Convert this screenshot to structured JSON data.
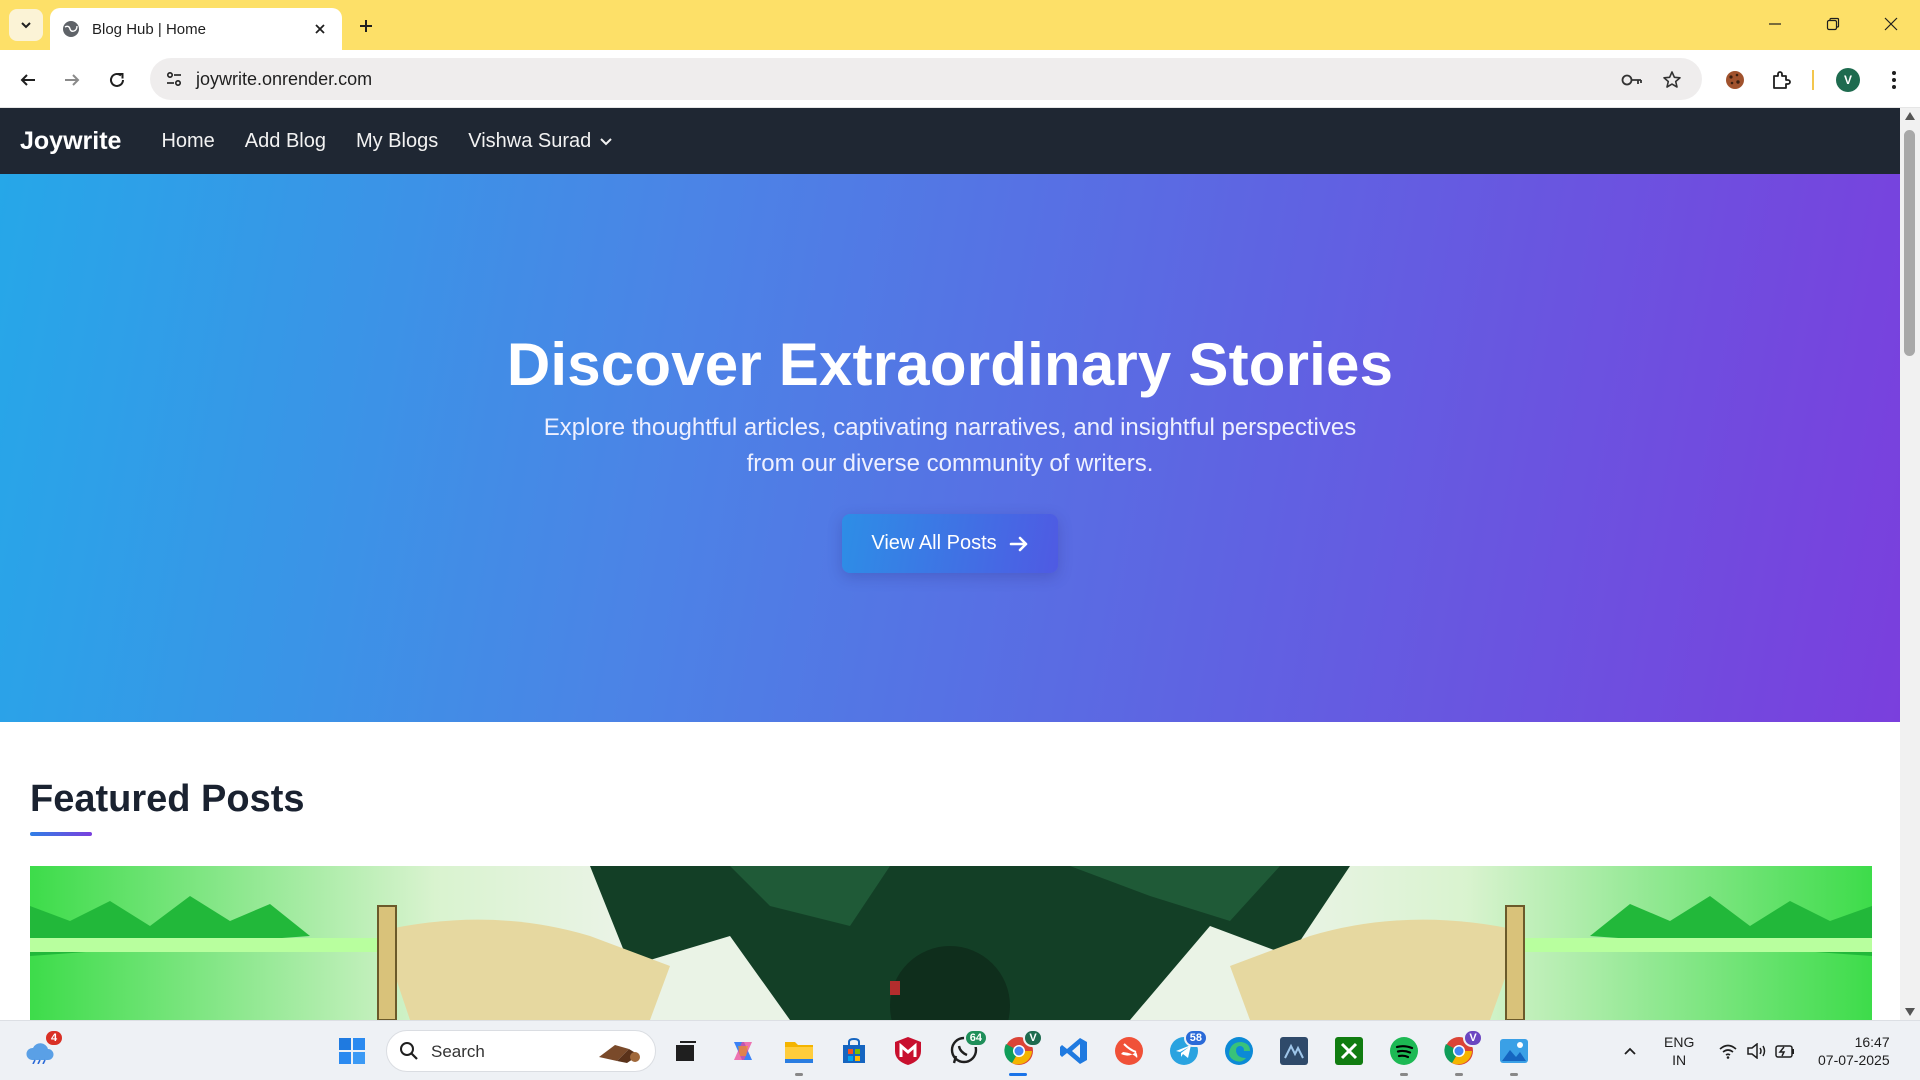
{
  "browser": {
    "tab_title": "Blog Hub | Home",
    "url": "joywrite.onrender.com",
    "profile_initial": "V",
    "frame_color": "#fde068"
  },
  "site": {
    "brand": "Joywrite",
    "nav": [
      "Home",
      "Add Blog",
      "My Blogs"
    ],
    "user_menu": "Vishwa Surad"
  },
  "hero": {
    "title": "Discover Extraordinary Stories",
    "subtitle_line1": "Explore thoughtful articles, captivating narratives, and insightful perspectives",
    "subtitle_line2": "from our diverse community of writers.",
    "button": "View All Posts",
    "gradient_start": "#26a7e8",
    "gradient_end": "#7a3fdd"
  },
  "featured": {
    "heading": "Featured Posts"
  },
  "taskbar": {
    "search_placeholder": "Search",
    "weather_badge": "4",
    "whatsapp_badge": "64",
    "telegram_badge": "58",
    "chrome_profile_badge": "V",
    "chrome2_profile_badge": "V",
    "language_line1": "ENG",
    "language_line2": "IN",
    "time": "16:47",
    "date": "07-07-2025",
    "apps": [
      "weather",
      "start",
      "search",
      "task-view",
      "copilot",
      "file-explorer",
      "microsoft-store",
      "mcafee",
      "whatsapp",
      "chrome",
      "vscode",
      "swift",
      "telegram",
      "edge",
      "mysql-workbench",
      "xbox",
      "spotify",
      "chrome-profile",
      "photos"
    ]
  }
}
